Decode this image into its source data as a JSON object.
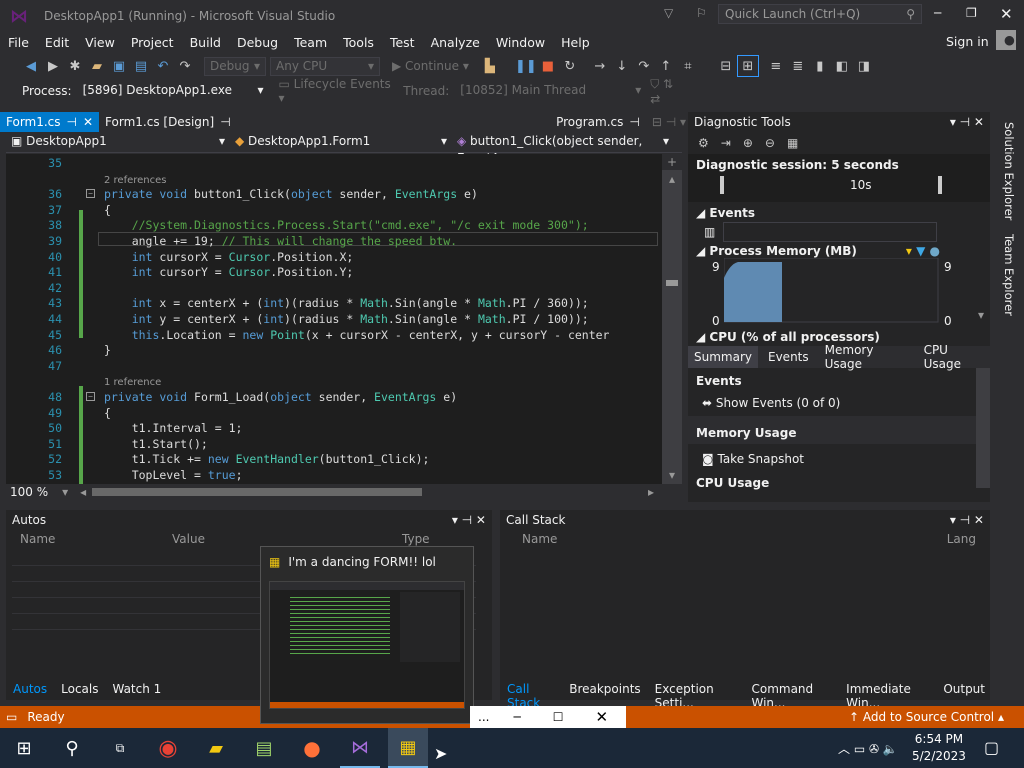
{
  "window": {
    "title": "DesktopApp1 (Running) - Microsoft Visual Studio",
    "quick_launch": "Quick Launch (Ctrl+Q)",
    "sign_in": "Sign in"
  },
  "menu": [
    "File",
    "Edit",
    "View",
    "Project",
    "Build",
    "Debug",
    "Team",
    "Tools",
    "Test",
    "Analyze",
    "Window",
    "Help"
  ],
  "toolbar": {
    "config": "Debug",
    "platform": "Any CPU",
    "continue": "Continue"
  },
  "process_bar": {
    "process_label": "Process:",
    "process_value": "[5896] DesktopApp1.exe",
    "lifecycle": "Lifecycle Events",
    "thread_label": "Thread:",
    "thread_value": "[10852] Main Thread"
  },
  "tabs": [
    {
      "label": "Form1.cs",
      "active": true
    },
    {
      "label": "Form1.cs [Design]",
      "active": false
    },
    {
      "label": "Program.cs",
      "active": false
    }
  ],
  "nav": {
    "project": "DesktopApp1",
    "class": "DesktopApp1.Form1",
    "member": "button1_Click(object sender, EventA"
  },
  "editor": {
    "zoom": "100 %",
    "lines": [
      {
        "n": "35",
        "html": ""
      },
      {
        "n": "",
        "ref": "2 references"
      },
      {
        "n": "36",
        "html": "<span class='kw'>private void</span> button1_Click(<span class='kw'>object</span> sender, <span class='ty'>EventArgs</span> e)"
      },
      {
        "n": "37",
        "html": "{"
      },
      {
        "n": "38",
        "html": "    <span class='cm'>//System.Diagnostics.Process.Start(\"cmd.exe\", \"/c exit mode 300\");</span>"
      },
      {
        "n": "39",
        "html": "    angle += 19; <span class='cm'>// This will change the speed btw.</span>"
      },
      {
        "n": "40",
        "html": "    <span class='kw'>int</span> cursorX = <span class='cl'>Cursor</span>.Position.X;"
      },
      {
        "n": "41",
        "html": "    <span class='kw'>int</span> cursorY = <span class='cl'>Cursor</span>.Position.Y;"
      },
      {
        "n": "42",
        "html": ""
      },
      {
        "n": "43",
        "html": "    <span class='kw'>int</span> x = centerX + (<span class='kw'>int</span>)(radius * <span class='cl'>Math</span>.Sin(angle * <span class='cl'>Math</span>.PI / 360));"
      },
      {
        "n": "44",
        "html": "    <span class='kw'>int</span> y = centerX + (<span class='kw'>int</span>)(radius * <span class='cl'>Math</span>.Sin(angle * <span class='cl'>Math</span>.PI / 100));"
      },
      {
        "n": "45",
        "html": "    <span class='kw'>this</span>.Location = <span class='kw'>new</span> <span class='ty'>Point</span>(x + cursorX - centerX, y + cursorY - center"
      },
      {
        "n": "46",
        "html": "}"
      },
      {
        "n": "47",
        "html": ""
      },
      {
        "n": "",
        "ref": "1 reference"
      },
      {
        "n": "48",
        "html": "<span class='kw'>private void</span> Form1_Load(<span class='kw'>object</span> sender, <span class='ty'>EventArgs</span> e)"
      },
      {
        "n": "49",
        "html": "{"
      },
      {
        "n": "50",
        "html": "    t1.Interval = 1;"
      },
      {
        "n": "51",
        "html": "    t1.Start();"
      },
      {
        "n": "52",
        "html": "    t1.Tick += <span class='kw'>new</span> <span class='ty'>EventHandler</span>(button1_Click);"
      },
      {
        "n": "53",
        "html": "    TopLevel = <span class='kw'>true</span>;"
      }
    ]
  },
  "diagnostics": {
    "title": "Diagnostic Tools",
    "session": "Diagnostic session: 5 seconds",
    "time_label": "10s",
    "events": "Events",
    "process_memory": "Process Memory (MB)",
    "mem_max": "9",
    "mem_min": "0",
    "cpu": "CPU (% of all processors)",
    "tabs": [
      "Summary",
      "Events",
      "Memory Usage",
      "CPU Usage"
    ],
    "summary_events": "Events",
    "show_events": "Show Events (0 of 0)",
    "memory_usage": "Memory Usage",
    "take_snapshot": "Take Snapshot",
    "cpu_usage": "CPU Usage"
  },
  "autos": {
    "title": "Autos",
    "cols": [
      "Name",
      "Value",
      "Type"
    ],
    "tabs": [
      "Autos",
      "Locals",
      "Watch 1"
    ]
  },
  "callstack": {
    "title": "Call Stack",
    "cols": [
      "Name",
      "Lang"
    ],
    "tabs": [
      "Call Stack",
      "Breakpoints",
      "Exception Setti...",
      "Command Win...",
      "Immediate Win...",
      "Output"
    ]
  },
  "side_tabs": [
    "Solution Explorer",
    "Team Explorer"
  ],
  "status": {
    "ready": "Ready",
    "source_control": "Add to Source Control"
  },
  "popup": {
    "title": "I'm a dancing FORM!! lol"
  },
  "taskbar": {
    "time": "6:54 PM",
    "date": "5/2/2023"
  }
}
